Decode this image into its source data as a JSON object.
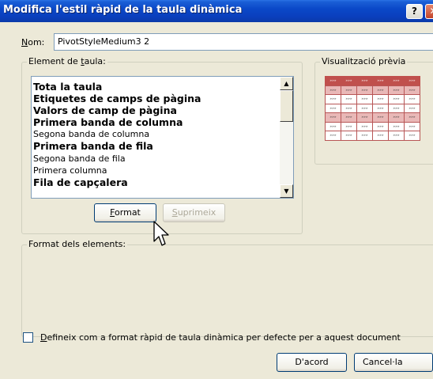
{
  "window": {
    "title": "Modifica l'estil ràpid de la taula dinàmica",
    "help_label": "?",
    "close_label": "✕"
  },
  "name": {
    "label_first": "N",
    "label_rest": "om:",
    "value": "PivotStyleMedium3 2"
  },
  "element_group": {
    "legend_prefix": "Element de ",
    "legend_underlined": "t",
    "legend_rest": "aula:",
    "items": [
      {
        "label": "Tota la taula",
        "bold": true
      },
      {
        "label": "Etiquetes de camps de pàgina",
        "bold": true
      },
      {
        "label": "Valors de camp de pàgina",
        "bold": true
      },
      {
        "label": "Primera banda de columna",
        "bold": true
      },
      {
        "label": "Segona banda de columna",
        "bold": false
      },
      {
        "label": "Primera banda de fila",
        "bold": true
      },
      {
        "label": "Segona banda de fila",
        "bold": false
      },
      {
        "label": "Primera columna",
        "bold": false
      },
      {
        "label": "Fila de capçalera",
        "bold": true
      }
    ],
    "format_button_first": "F",
    "format_button_rest": "ormat",
    "delete_button_first": "S",
    "delete_button_rest": "uprimeix"
  },
  "preview": {
    "legend": "Visualització prèvia",
    "cell_text": "»»»",
    "row_styles": [
      "head",
      "band",
      "plain",
      "plain",
      "band",
      "plain",
      "plain"
    ]
  },
  "format_group": {
    "legend": "Format dels elements:"
  },
  "default_option": {
    "checked": false,
    "label_first": "D",
    "label_rest": "efineix com a format ràpid de taula dinàmica per defecte per a aquest document"
  },
  "buttons": {
    "ok": "D'acord",
    "cancel": "Cancel·la"
  },
  "colors": {
    "title_bar": "#0a48c8",
    "dialog_bg": "#ece9d8",
    "preview_header": "#c0504d",
    "preview_band": "#e9b8b7"
  }
}
